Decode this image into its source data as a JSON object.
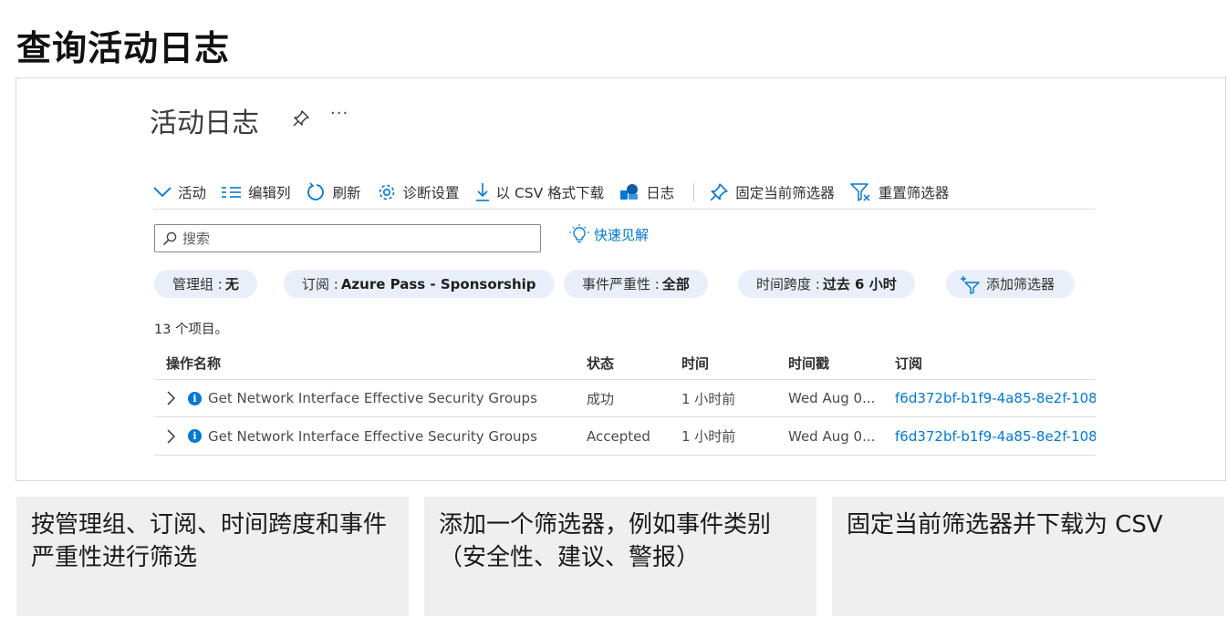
{
  "slide_title": "查询活动日志",
  "blade": {
    "title": "活动日志",
    "more": "···"
  },
  "toolbar": {
    "activity": "活动",
    "edit_columns": "编辑列",
    "refresh": "刷新",
    "diagnostic_settings": "诊断设置",
    "download_csv": "以 CSV 格式下载",
    "logs": "日志",
    "pin_filters": "固定当前筛选器",
    "reset_filters": "重置筛选器"
  },
  "search": {
    "placeholder": "搜索"
  },
  "quick_insights": "快速见解",
  "filters": [
    {
      "label": "管理组 :",
      "value": "无"
    },
    {
      "label": "订阅 :",
      "value": "Azure Pass - Sponsorship"
    },
    {
      "label": "事件严重性 :",
      "value": "全部"
    },
    {
      "label": "时间跨度 :",
      "value": "过去 6 小时"
    }
  ],
  "add_filter": "添加筛选器",
  "item_count": "13 个项目。",
  "table": {
    "columns": [
      "操作名称",
      "状态",
      "时间",
      "时间戳",
      "订阅"
    ],
    "rows": [
      {
        "name": "Get Network Interface Effective Security Groups",
        "status": "成功",
        "time": "1 小时前",
        "timestamp": "Wed Aug 0...",
        "subscription": "f6d372bf-b1f9-4a85-8e2f-108"
      },
      {
        "name": "Get Network Interface Effective Security Groups",
        "status": "Accepted",
        "time": "1 小时前",
        "timestamp": "Wed Aug 0...",
        "subscription": "f6d372bf-b1f9-4a85-8e2f-108"
      }
    ]
  },
  "notes": [
    "按管理组、订阅、时间跨度和事件严重性进行筛选",
    "添加一个筛选器，例如事件类别（安全性、建议、警报）",
    "固定当前筛选器并下载为 CSV"
  ],
  "colors": {
    "accent": "#0078d4",
    "pill_bg": "#e8eff9",
    "note_bg": "#efefef"
  }
}
